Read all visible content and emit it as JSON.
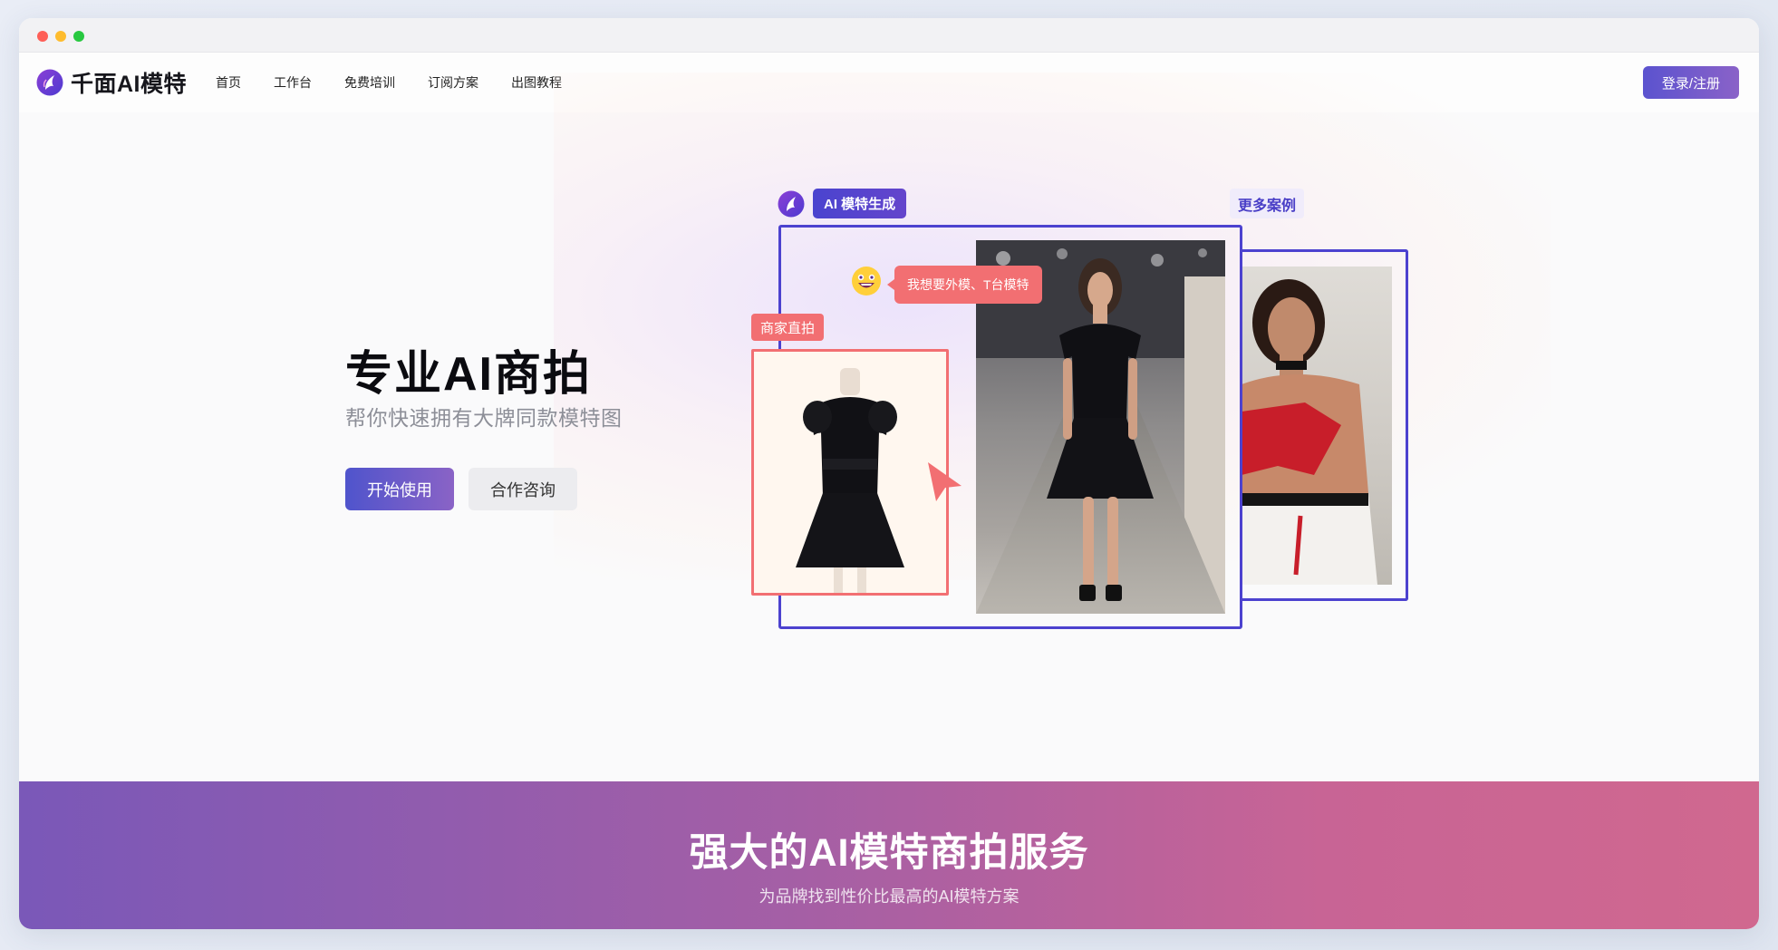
{
  "app": {
    "name": "千面AI模特"
  },
  "nav": {
    "items": [
      {
        "label": "首页"
      },
      {
        "label": "工作台"
      },
      {
        "label": "免费培训"
      },
      {
        "label": "订阅方案"
      },
      {
        "label": "出图教程"
      }
    ],
    "login_label": "登录/注册"
  },
  "hero": {
    "title": "专业AI商拍",
    "subtitle": "帮你快速拥有大牌同款模特图",
    "start_label": "开始使用",
    "consult_label": "合作咨询"
  },
  "showcase": {
    "ai_tag": "AI 模特生成",
    "more_label": "更多案例",
    "merchant_tag": "商家直拍",
    "bubble": "我想要外模、T台模特"
  },
  "banner": {
    "title": "强大的AI模特商拍服务",
    "subtitle": "为品牌找到性价比最高的AI模特方案"
  },
  "colors": {
    "brand": "#5b53cf",
    "accent_coral": "#f26f72",
    "frame": "#4c42cf"
  }
}
